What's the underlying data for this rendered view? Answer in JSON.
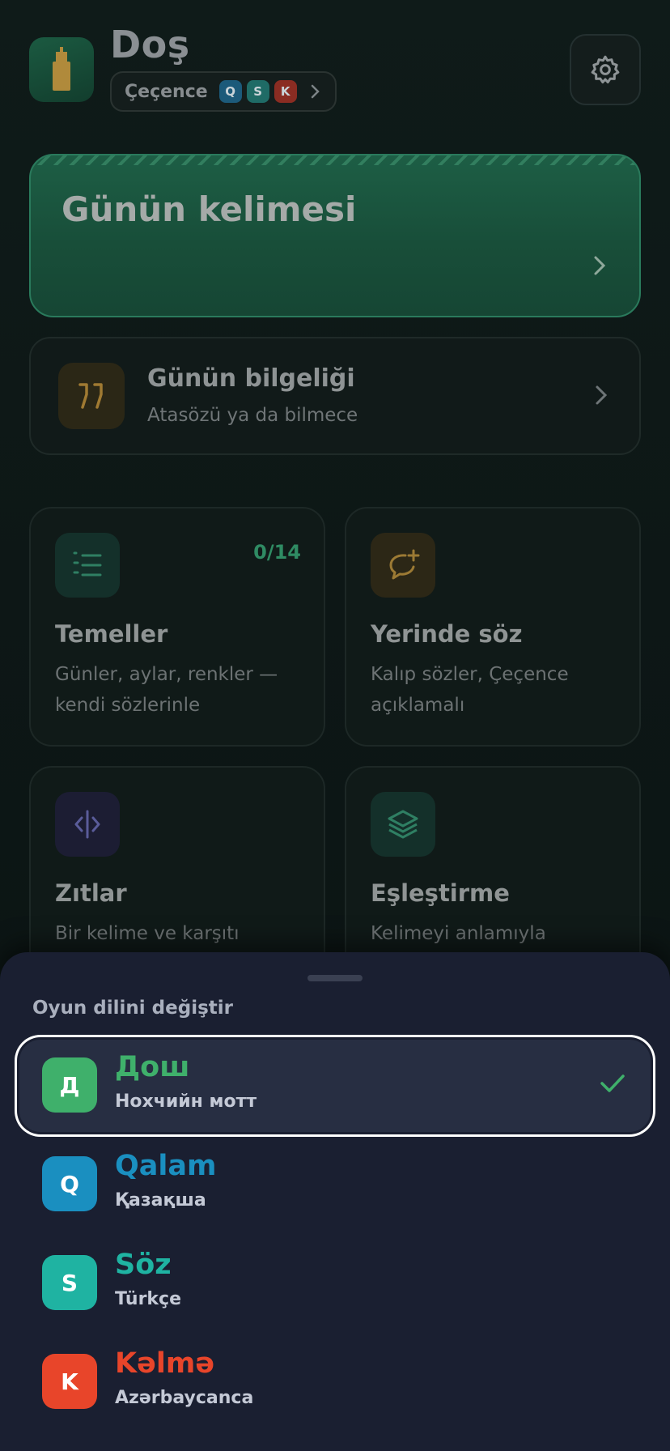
{
  "header": {
    "app_title": "Doş",
    "language_label": "Çeçence",
    "mini_apps": [
      {
        "letter": "Q",
        "color": "#1c5a7a"
      },
      {
        "letter": "S",
        "color": "#1f6b66"
      },
      {
        "letter": "K",
        "color": "#8a2c22"
      }
    ],
    "settings_icon": "gear-icon"
  },
  "word_of_day": {
    "title": "Günün kelimesi"
  },
  "wisdom": {
    "title": "Günün bilgeliği",
    "subtitle": "Atasözü ya da bilmece",
    "icon": "quote-icon"
  },
  "cards": [
    {
      "title": "Temeller",
      "desc": "Günler, aylar, renkler — kendi sözlerinle",
      "progress": "0/14",
      "icon": "list-icon"
    },
    {
      "title": "Yerinde söz",
      "desc": "Kalıp sözler, Çeçence açıklamalı",
      "icon": "chat-plus-icon"
    },
    {
      "title": "Zıtlar",
      "desc": "Bir kelime ve karşıtı",
      "icon": "split-icon"
    },
    {
      "title": "Eşleştirme",
      "desc": "Kelimeyi anlamıyla",
      "icon": "layers-icon"
    }
  ],
  "sheet": {
    "title": "Oyun dilini değiştir",
    "options": [
      {
        "letter": "Д",
        "name": "Дош",
        "sub": "Нохчийн мотт",
        "color": "#3fb06b",
        "selected": true
      },
      {
        "letter": "Q",
        "name": "Qalam",
        "sub": "Қазақша",
        "color": "#1a8fc0",
        "selected": false
      },
      {
        "letter": "S",
        "name": "Söz",
        "sub": "Türkçe",
        "color": "#1fb3a2",
        "selected": false
      },
      {
        "letter": "K",
        "name": "Kəlmə",
        "sub": "Azərbaycanca",
        "color": "#e8452a",
        "selected": false
      }
    ]
  }
}
